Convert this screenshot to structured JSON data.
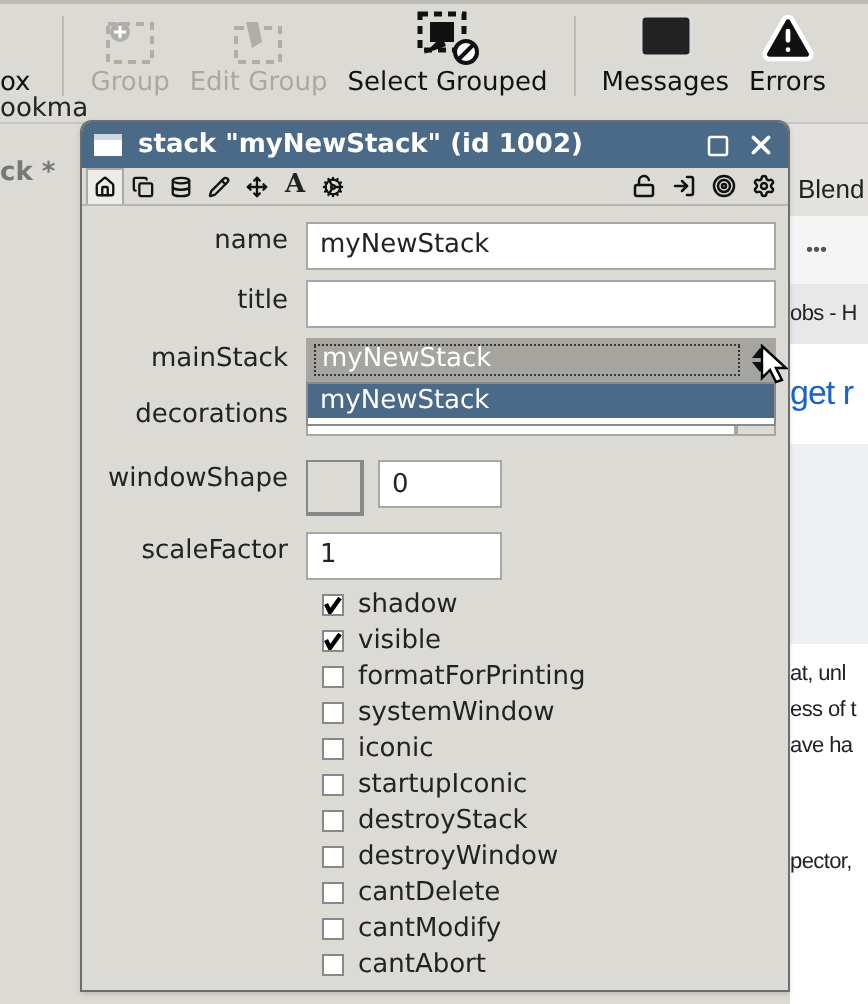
{
  "toolbar": {
    "items": [
      {
        "kind": "partial",
        "label": "ox",
        "disabled": false
      },
      {
        "kind": "group",
        "label": "Group",
        "disabled": true
      },
      {
        "kind": "edit-group",
        "label": "Edit Group",
        "disabled": true
      },
      {
        "kind": "select-grouped",
        "label": "Select Grouped",
        "disabled": false
      },
      {
        "kind": "messages",
        "label": "Messages",
        "disabled": false
      },
      {
        "kind": "errors",
        "label": "Errors",
        "disabled": false
      }
    ]
  },
  "background_left": {
    "bookmarks_fragment": "ookma",
    "tab_fragment": "ck *"
  },
  "background_browser": {
    "tab_fragment": "Blend",
    "menu": "•••",
    "link_fragment": "obs - H",
    "heading_fragment": "get r",
    "lines": [
      "at, unl",
      "ess of t",
      "ave ha"
    ],
    "last_line": "pector,"
  },
  "palette": {
    "title": "stack \"myNewStack\" (id 1002)",
    "tabs": [
      {
        "kind": "home",
        "selected": true
      },
      {
        "kind": "copy",
        "selected": false
      },
      {
        "kind": "database",
        "selected": false
      },
      {
        "kind": "pencil",
        "selected": false
      },
      {
        "kind": "move",
        "selected": false
      },
      {
        "kind": "text",
        "label": "A",
        "selected": false
      },
      {
        "kind": "gears",
        "selected": false
      }
    ],
    "tools": [
      {
        "kind": "lock"
      },
      {
        "kind": "import"
      },
      {
        "kind": "target"
      },
      {
        "kind": "gear"
      }
    ],
    "fields": [
      {
        "kind": "text",
        "label": "name",
        "value": "myNewStack"
      },
      {
        "kind": "text",
        "label": "title"
      },
      {
        "kind": "select",
        "label": "mainStack",
        "value": "myNewStack",
        "options": [
          {
            "label": "myNewStack",
            "selected": true
          }
        ]
      },
      {
        "kind": "select-covered",
        "label": "decorations"
      },
      {
        "kind": "shape",
        "label": "windowShape",
        "value": "0"
      },
      {
        "kind": "short",
        "label": "scaleFactor",
        "value": "1"
      }
    ],
    "checkboxes": [
      {
        "label": "shadow",
        "checked": true
      },
      {
        "label": "visible",
        "checked": true
      },
      {
        "label": "formatForPrinting",
        "checked": false
      },
      {
        "label": "systemWindow",
        "checked": false
      },
      {
        "label": "iconic",
        "checked": false
      },
      {
        "label": "startupIconic",
        "checked": false
      },
      {
        "label": "destroyStack",
        "checked": false
      },
      {
        "label": "destroyWindow",
        "checked": false
      },
      {
        "label": "cantDelete",
        "checked": false
      },
      {
        "label": "cantModify",
        "checked": false
      },
      {
        "label": "cantAbort",
        "checked": false
      }
    ]
  }
}
